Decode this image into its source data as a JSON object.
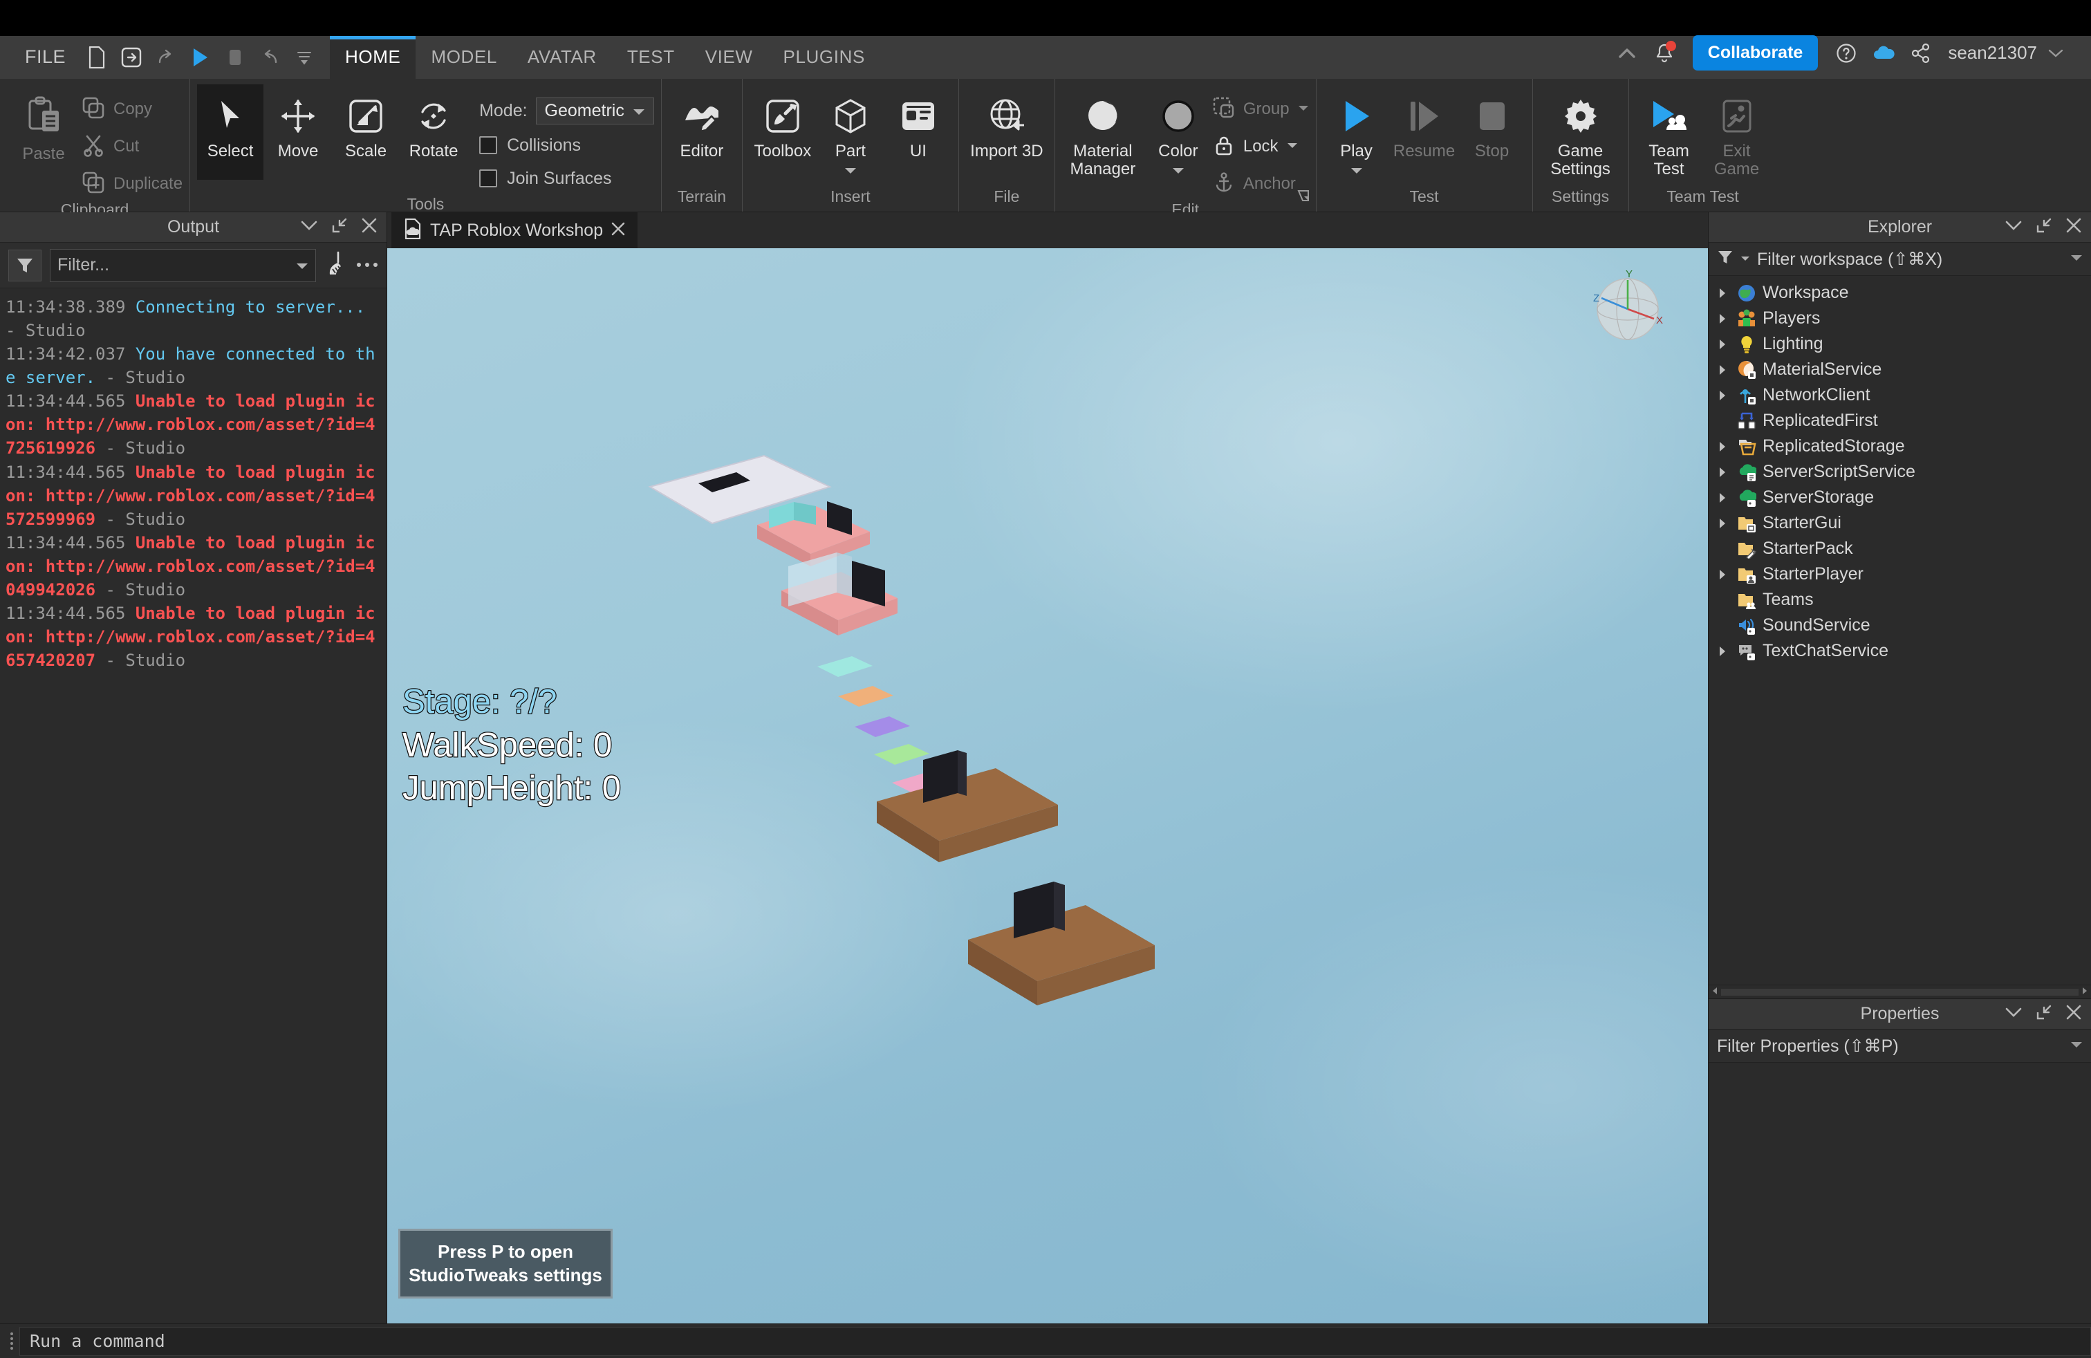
{
  "menubar": {
    "file_label": "FILE",
    "quick_actions": [
      {
        "name": "new-file-icon",
        "label": "New"
      },
      {
        "name": "open-file-icon",
        "label": "Open"
      },
      {
        "name": "redo-icon",
        "label": "Redo"
      },
      {
        "name": "play-icon",
        "label": "Play"
      },
      {
        "name": "stop-icon",
        "label": "Stop"
      },
      {
        "name": "undo-icon",
        "label": "Undo"
      },
      {
        "name": "overflow-icon",
        "label": "More"
      }
    ],
    "tabs": [
      {
        "label": "HOME",
        "active": true
      },
      {
        "label": "MODEL",
        "active": false
      },
      {
        "label": "AVATAR",
        "active": false
      },
      {
        "label": "TEST",
        "active": false
      },
      {
        "label": "VIEW",
        "active": false
      },
      {
        "label": "PLUGINS",
        "active": false
      }
    ],
    "collaborate_label": "Collaborate",
    "username": "sean21307",
    "accent_color": "#0a84e0",
    "notification_badge_color": "#e8443a"
  },
  "ribbon": {
    "groups": [
      {
        "label": "Clipboard",
        "paste_label": "Paste",
        "items": [
          {
            "label": "Copy",
            "icon": "copy-icon",
            "disabled": true
          },
          {
            "label": "Cut",
            "icon": "cut-icon",
            "disabled": true
          },
          {
            "label": "Duplicate",
            "icon": "duplicate-icon",
            "disabled": true
          }
        ]
      },
      {
        "label": "Tools",
        "items": [
          {
            "label": "Select",
            "icon": "cursor-icon",
            "selected": true
          },
          {
            "label": "Move",
            "icon": "move-arrows-icon",
            "selected": false
          },
          {
            "label": "Scale",
            "icon": "scale-icon",
            "selected": false
          },
          {
            "label": "Rotate",
            "icon": "rotate-icon",
            "selected": false
          }
        ],
        "mode_label": "Mode:",
        "mode_value": "Geometric",
        "checkboxes": [
          {
            "label": "Collisions",
            "checked": false
          },
          {
            "label": "Join Surfaces",
            "checked": false
          }
        ]
      },
      {
        "label": "Terrain",
        "items": [
          {
            "label": "Editor",
            "icon": "terrain-editor-icon"
          }
        ]
      },
      {
        "label": "Insert",
        "items": [
          {
            "label": "Toolbox",
            "icon": "toolbox-icon"
          },
          {
            "label": "Part",
            "icon": "part-cube-icon",
            "has_caret": true
          },
          {
            "label": "UI",
            "icon": "ui-panel-icon"
          }
        ]
      },
      {
        "label": "File",
        "items": [
          {
            "label": "Import 3D",
            "icon": "import-3d-globe-icon"
          }
        ]
      },
      {
        "label": "Edit",
        "items": [
          {
            "label": "Material Manager",
            "icon": "material-sphere-icon"
          },
          {
            "label": "Color",
            "icon": "color-swatch-icon",
            "has_caret": true
          }
        ],
        "small_items": [
          {
            "label": "Group",
            "icon": "group-icon",
            "disabled": true,
            "has_caret": true
          },
          {
            "label": "Lock",
            "icon": "lock-icon",
            "disabled": false,
            "has_caret": true
          },
          {
            "label": "Anchor",
            "icon": "anchor-icon",
            "disabled": true
          }
        ]
      },
      {
        "label": "Test",
        "items": [
          {
            "label": "Play",
            "icon": "play-icon",
            "has_caret": true,
            "disabled": false
          },
          {
            "label": "Resume",
            "icon": "resume-icon",
            "disabled": true
          },
          {
            "label": "Stop",
            "icon": "stop-icon",
            "disabled": true
          }
        ]
      },
      {
        "label": "Settings",
        "items": [
          {
            "label": "Game Settings",
            "icon": "gear-icon"
          }
        ]
      },
      {
        "label": "Team Test",
        "items": [
          {
            "label": "Team Test",
            "icon": "team-test-icon"
          },
          {
            "label": "Exit Game",
            "icon": "exit-game-icon",
            "disabled": true
          }
        ]
      }
    ]
  },
  "output": {
    "title": "Output",
    "filter_placeholder": "Filter...",
    "lines": [
      {
        "time": "11:34:38.389",
        "text": "Connecting to server...",
        "source": "- Studio",
        "level": "info"
      },
      {
        "time": "11:34:42.037",
        "text": "You have connected to the server.",
        "source": "- Studio",
        "level": "info"
      },
      {
        "time": "11:34:44.565",
        "text": "Unable to load plugin icon: http://www.roblox.com/asset/?id=4725619926",
        "source": "- Studio",
        "level": "error"
      },
      {
        "time": "11:34:44.565",
        "text": "Unable to load plugin icon: http://www.roblox.com/asset/?id=4572599969",
        "source": "- Studio",
        "level": "error"
      },
      {
        "time": "11:34:44.565",
        "text": "Unable to load plugin icon: http://www.roblox.com/asset/?id=4049942026",
        "source": "- Studio",
        "level": "error"
      },
      {
        "time": "11:34:44.565",
        "text": "Unable to load plugin icon: http://www.roblox.com/asset/?id=4657420207",
        "source": "- Studio",
        "level": "error"
      }
    ]
  },
  "viewport": {
    "tab_label": "TAP Roblox Workshop",
    "hud": {
      "stage": "Stage: ?/?",
      "walkspeed": "WalkSpeed: 0",
      "jumpheight": "JumpHeight: 0",
      "stage_color": "#8fd6f2"
    },
    "toast": "Press P to open StudioTweaks settings",
    "gizmo_axes": [
      "Z",
      "X",
      "Y"
    ]
  },
  "explorer": {
    "title": "Explorer",
    "filter_placeholder": "Filter workspace (⇧⌘X)",
    "items": [
      {
        "label": "Workspace",
        "icon": "workspace-icon",
        "expandable": true,
        "color": "#3b7fd4"
      },
      {
        "label": "Players",
        "icon": "players-icon",
        "expandable": true,
        "color": "#e8913a"
      },
      {
        "label": "Lighting",
        "icon": "lighting-bulb-icon",
        "expandable": true,
        "color": "#f2d43a"
      },
      {
        "label": "MaterialService",
        "icon": "material-service-icon",
        "expandable": true,
        "color": "#e8913a"
      },
      {
        "label": "NetworkClient",
        "icon": "network-client-icon",
        "expandable": true,
        "color": "#3aa8dd"
      },
      {
        "label": "ReplicatedFirst",
        "icon": "replicated-first-icon",
        "expandable": false,
        "color": "#3b63d4"
      },
      {
        "label": "ReplicatedStorage",
        "icon": "replicated-storage-icon",
        "expandable": true,
        "color": "#e8a93a"
      },
      {
        "label": "ServerScriptService",
        "icon": "server-script-service-icon",
        "expandable": true,
        "color": "#22a95e"
      },
      {
        "label": "ServerStorage",
        "icon": "server-storage-icon",
        "expandable": true,
        "color": "#22a95e"
      },
      {
        "label": "StarterGui",
        "icon": "starter-gui-folder-icon",
        "expandable": true,
        "color": "#f2ca74"
      },
      {
        "label": "StarterPack",
        "icon": "starter-pack-folder-icon",
        "expandable": false,
        "color": "#f2ca74"
      },
      {
        "label": "StarterPlayer",
        "icon": "starter-player-folder-icon",
        "expandable": true,
        "color": "#f2ca74"
      },
      {
        "label": "Teams",
        "icon": "teams-folder-icon",
        "expandable": false,
        "color": "#f2ca74"
      },
      {
        "label": "SoundService",
        "icon": "sound-service-icon",
        "expandable": false,
        "color": "#3a8fdd"
      },
      {
        "label": "TextChatService",
        "icon": "text-chat-service-icon",
        "expandable": true,
        "color": "#b8b8b8"
      }
    ]
  },
  "properties": {
    "title": "Properties",
    "filter_placeholder": "Filter Properties (⇧⌘P)"
  },
  "command_bar": {
    "placeholder": "Run a command"
  }
}
